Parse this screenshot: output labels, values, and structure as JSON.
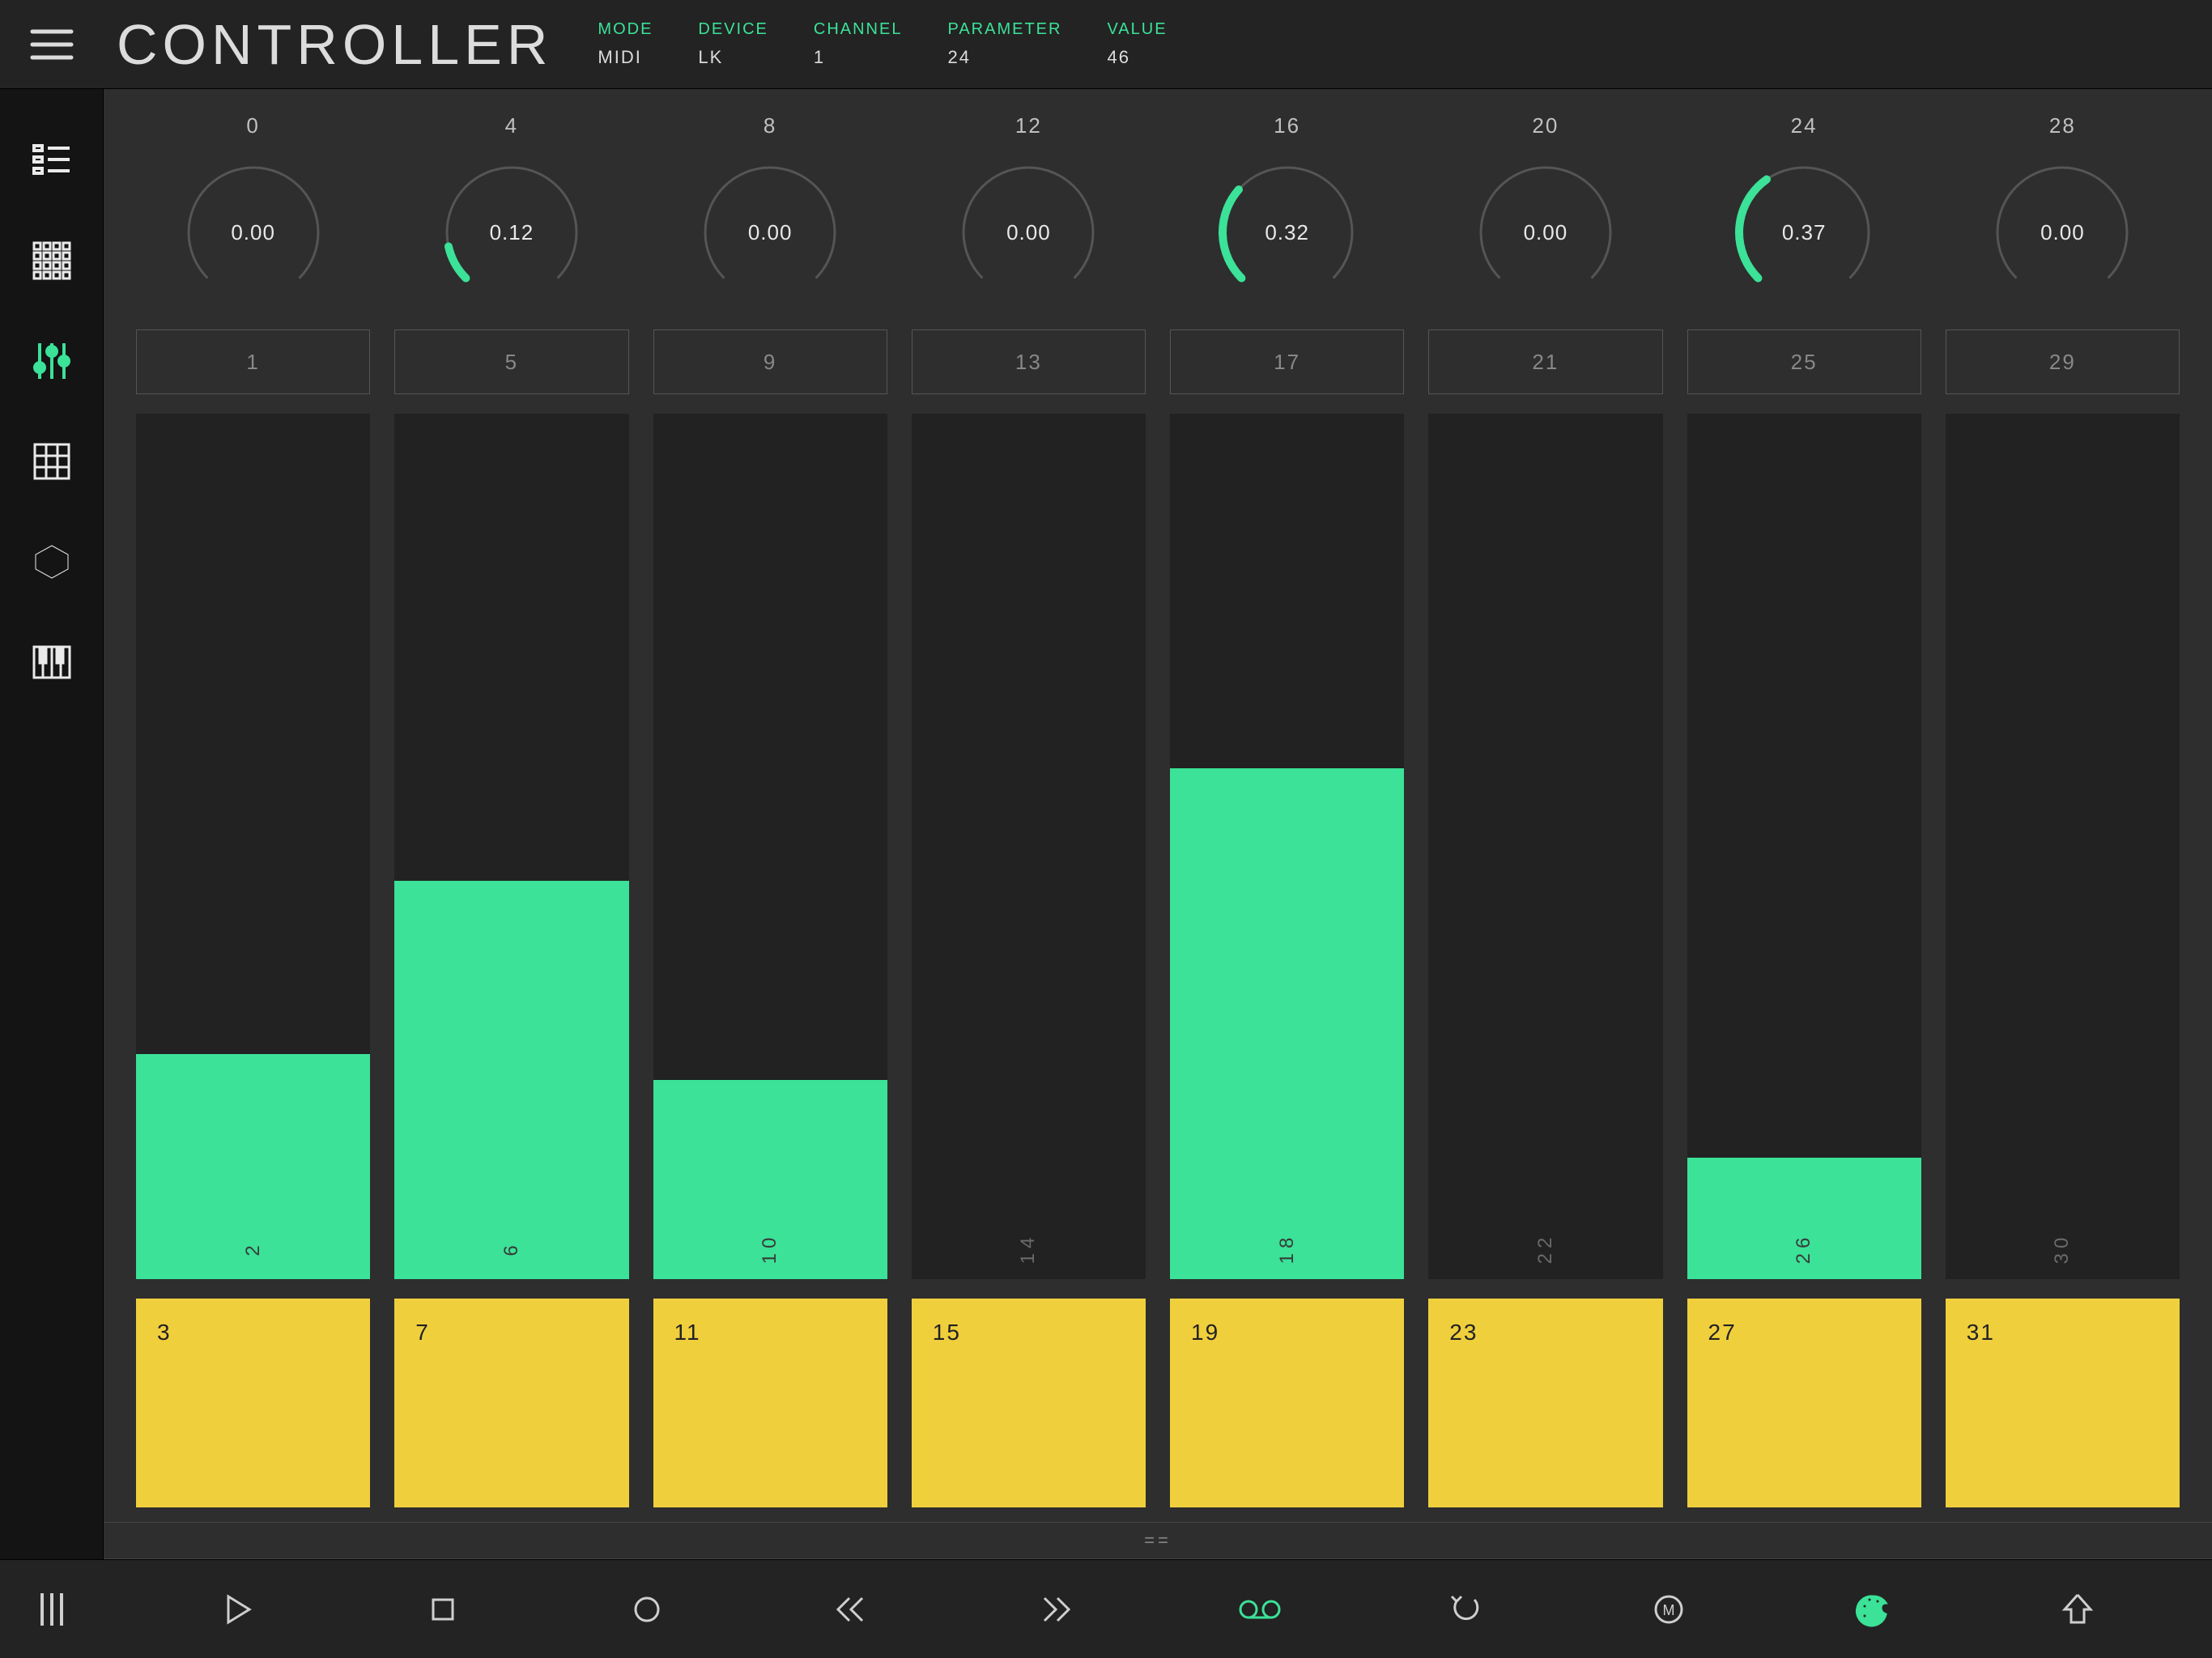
{
  "app": {
    "title": "CONTROLLER"
  },
  "header": {
    "mode_label": "MODE",
    "mode_value": "MIDI",
    "device_label": "DEVICE",
    "device_value": "LK",
    "channel_label": "CHANNEL",
    "channel_value": "1",
    "parameter_label": "PARAMETER",
    "parameter_value": "24",
    "value_label": "VALUE",
    "value_value": "46"
  },
  "colors": {
    "accent": "#3be298",
    "yellow": "#f0cf3d"
  },
  "knobs": [
    {
      "id": "0",
      "value": 0.0,
      "display": "0.00"
    },
    {
      "id": "4",
      "value": 0.12,
      "display": "0.12"
    },
    {
      "id": "8",
      "value": 0.0,
      "display": "0.00"
    },
    {
      "id": "12",
      "value": 0.0,
      "display": "0.00"
    },
    {
      "id": "16",
      "value": 0.32,
      "display": "0.32"
    },
    {
      "id": "20",
      "value": 0.0,
      "display": "0.00"
    },
    {
      "id": "24",
      "value": 0.37,
      "display": "0.37"
    },
    {
      "id": "28",
      "value": 0.0,
      "display": "0.00"
    }
  ],
  "label_buttons": [
    {
      "label": "1"
    },
    {
      "label": "5"
    },
    {
      "label": "9"
    },
    {
      "label": "13"
    },
    {
      "label": "17"
    },
    {
      "label": "21"
    },
    {
      "label": "25"
    },
    {
      "label": "29"
    }
  ],
  "faders": [
    {
      "id": "2",
      "value": 0.26
    },
    {
      "id": "6",
      "value": 0.46
    },
    {
      "id": "10",
      "value": 0.23
    },
    {
      "id": "14",
      "value": 0.0
    },
    {
      "id": "18",
      "value": 0.59
    },
    {
      "id": "22",
      "value": 0.0
    },
    {
      "id": "26",
      "value": 0.14
    },
    {
      "id": "30",
      "value": 0.0
    }
  ],
  "pads": [
    {
      "label": "3"
    },
    {
      "label": "7"
    },
    {
      "label": "11"
    },
    {
      "label": "15"
    },
    {
      "label": "19"
    },
    {
      "label": "23"
    },
    {
      "label": "27"
    },
    {
      "label": "31"
    }
  ],
  "drag_handle": "==",
  "sidebar": {
    "items": [
      "clips",
      "matrix",
      "sliders",
      "grid",
      "hex",
      "keys"
    ],
    "active_index": 2
  },
  "transport": {
    "items": [
      "play",
      "stop",
      "record",
      "rewind",
      "forward",
      "loop",
      "undo",
      "metronome",
      "palette",
      "shift"
    ],
    "active": {
      "loop": true,
      "palette": true
    }
  }
}
